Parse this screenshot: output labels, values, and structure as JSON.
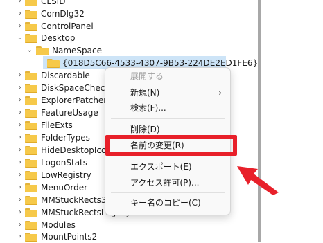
{
  "tree": {
    "items": [
      {
        "label": "CLSID"
      },
      {
        "label": "ComDlg32"
      },
      {
        "label": "ControlPanel"
      },
      {
        "label": "Desktop"
      },
      {
        "label": "NameSpace"
      },
      {
        "label": "{018D5C66-4533-4307-9B53-224DE2ED1FE6}"
      },
      {
        "label": "Discardable"
      },
      {
        "label": "DiskSpaceChecking"
      },
      {
        "label": "ExplorerPatcher"
      },
      {
        "label": "FeatureUsage"
      },
      {
        "label": "FileExts"
      },
      {
        "label": "FolderTypes"
      },
      {
        "label": "HideDesktopIcons"
      },
      {
        "label": "LogonStats"
      },
      {
        "label": "LowRegistry"
      },
      {
        "label": "MenuOrder"
      },
      {
        "label": "MMStuckRects3"
      },
      {
        "label": "MMStuckRectsLegacy"
      },
      {
        "label": "Modules"
      },
      {
        "label": "MountPoints2"
      }
    ]
  },
  "context_menu": {
    "expand": "展開する",
    "new": "新規(N)",
    "find": "検索(F)...",
    "delete": "削除(D)",
    "rename": "名前の変更(R)",
    "export": "エクスポート(E)",
    "permissions": "アクセス許可(P)...",
    "copy_key_name": "キー名のコピー(C)",
    "submenu_arrow": "›"
  },
  "glyphs": {
    "collapsed": "›",
    "expanded": "⌄"
  },
  "colors": {
    "highlight": "#e8202a",
    "selection": "#cde4f7",
    "folder": "#f6c94a"
  }
}
